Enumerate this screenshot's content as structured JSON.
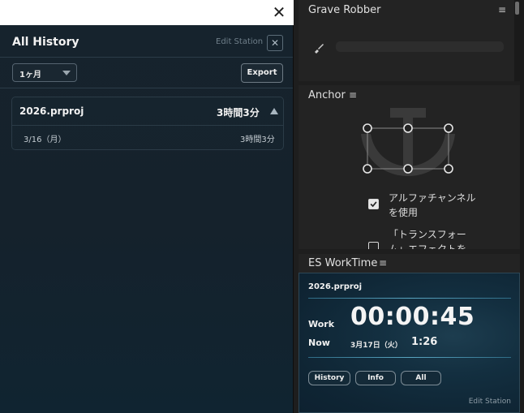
{
  "history_window": {
    "title": "All History",
    "edit_station": "Edit Station",
    "close_glyph": "✕",
    "range_select": {
      "value": "1ヶ月"
    },
    "export_label": "Export",
    "projects": [
      {
        "name": "2026.prproj",
        "total": "3時間3分",
        "days": [
          {
            "date": "3/16（月）",
            "time": "3時間3分"
          }
        ]
      }
    ]
  },
  "grave_robber": {
    "title": "Grave Robber",
    "menu_icon": "≡"
  },
  "anchor": {
    "title": "Anchor",
    "menu_icon": "≡",
    "options": [
      {
        "label": "アルファチャンネルを使用",
        "checked": true
      },
      {
        "label": "「トランスフォーム」エフェクトを",
        "checked": false
      }
    ]
  },
  "es_worktime": {
    "title": "ES WorkTime",
    "menu_icon": "≡",
    "project": "2026.prproj",
    "work_label": "Work",
    "work_time": "00:00:45",
    "now_label": "Now",
    "now_date": "3月17日（火）",
    "now_time": "1:26",
    "buttons": [
      "History",
      "Info",
      "All"
    ],
    "edit_station": "Edit Station"
  }
}
